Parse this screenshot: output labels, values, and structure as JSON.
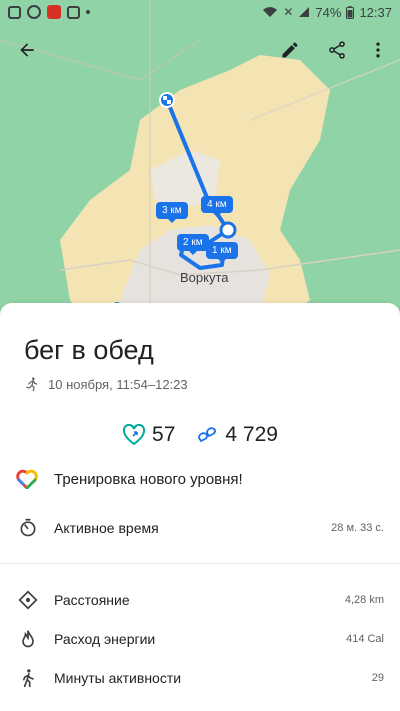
{
  "status_bar": {
    "battery": "74%",
    "time": "12:37"
  },
  "map": {
    "city_label": "Воркута",
    "markers": [
      {
        "label": "3 км"
      },
      {
        "label": "4 км"
      },
      {
        "label": "2 км"
      },
      {
        "label": "1 км"
      }
    ],
    "colors": {
      "route": "#1a73e8",
      "land": "#8fd3a6",
      "urban": "#f4e3b3"
    }
  },
  "workout": {
    "title": "бег в обед",
    "meta": "10 ноября, 11:54–12:23",
    "heart_points": "57",
    "steps": "4 729",
    "highlight": "Тренировка нового уровня!"
  },
  "details": {
    "active_time": {
      "label": "Активное время",
      "value": "28 м. 33 с."
    },
    "distance": {
      "label": "Расстояние",
      "value": "4,28 km"
    },
    "energy": {
      "label": "Расход энергии",
      "value": "414 Cal"
    },
    "active_minutes": {
      "label": "Минуты активности",
      "value": "29"
    }
  }
}
